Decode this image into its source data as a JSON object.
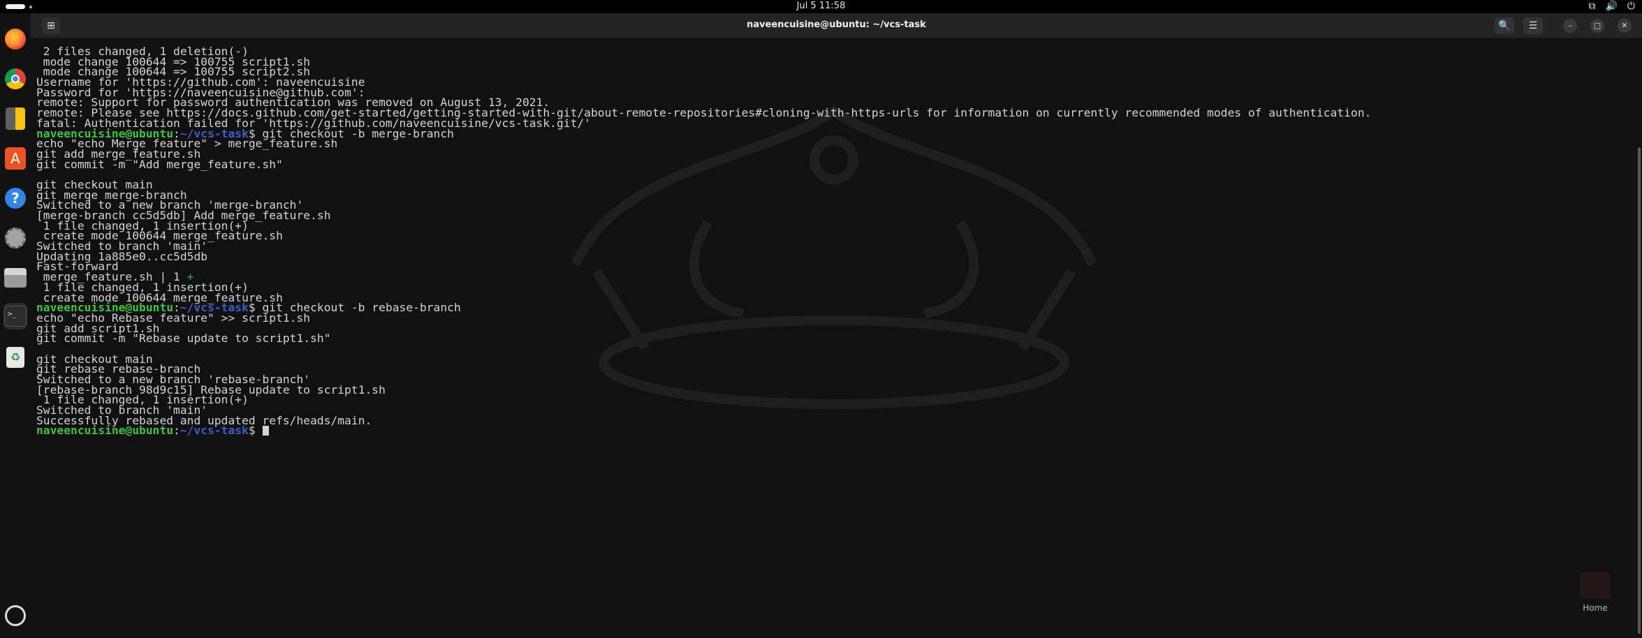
{
  "topbar": {
    "clock": "Jul 5  11:58",
    "tray_icons": [
      "network-icon",
      "volume-icon",
      "power-icon"
    ]
  },
  "dock": {
    "items": [
      {
        "name": "firefox",
        "icon": "firefox-icon"
      },
      {
        "name": "chrome",
        "icon": "chrome-icon"
      },
      {
        "name": "calculator",
        "icon": "calculator-icon"
      },
      {
        "name": "app-center",
        "icon": "app-store-icon",
        "glyph": "A"
      },
      {
        "name": "help",
        "icon": "help-icon",
        "glyph": "?"
      },
      {
        "name": "settings",
        "icon": "settings-icon"
      },
      {
        "name": "files",
        "icon": "files-icon"
      },
      {
        "name": "terminal",
        "icon": "terminal-icon",
        "glyph": ">_"
      },
      {
        "name": "trash",
        "icon": "trash-icon",
        "glyph": "♻"
      },
      {
        "name": "show-apps",
        "icon": "ubuntu-apps-icon"
      }
    ]
  },
  "window": {
    "title": "naveencuisine@ubuntu: ~/vcs-task",
    "buttons": {
      "search": "🔍",
      "menu": "☰",
      "minimize": "–",
      "maximize": "▢",
      "close": "✕"
    }
  },
  "terminal": {
    "prompt_user": "naveencuisine@ubuntu",
    "prompt_path": "~/vcs-task",
    "lines": [
      " 2 files changed, 1 deletion(-)",
      " mode change 100644 => 100755 script1.sh",
      " mode change 100644 => 100755 script2.sh",
      "Username for 'https://github.com': naveencuisine",
      "Password for 'https://naveencuisine@github.com':",
      "remote: Support for password authentication was removed on August 13, 2021.",
      "remote: Please see https://docs.github.com/get-started/getting-started-with-git/about-remote-repositories#cloning-with-https-urls for information on currently recommended modes of authentication.",
      "fatal: Authentication failed for 'https://github.com/naveencuisine/vcs-task.git/'",
      "@@PROMPT@@git checkout -b merge-branch",
      "echo \"echo Merge feature\" > merge_feature.sh",
      "git add merge_feature.sh",
      "git commit -m \"Add merge_feature.sh\"",
      "",
      "git checkout main",
      "git merge merge-branch",
      "Switched to a new branch 'merge-branch'",
      "[merge-branch cc5d5db] Add merge_feature.sh",
      " 1 file changed, 1 insertion(+)",
      " create mode 100644 merge_feature.sh",
      "Switched to branch 'main'",
      "Updating 1a885e0..cc5d5db",
      "Fast-forward",
      "@@DIFF@@ merge_feature.sh | 1 ",
      " 1 file changed, 1 insertion(+)",
      " create mode 100644 merge_feature.sh",
      "@@PROMPT@@git checkout -b rebase-branch",
      "echo \"echo Rebase feature\" >> script1.sh",
      "git add script1.sh",
      "git commit -m \"Rebase update to script1.sh\"",
      "",
      "git checkout main",
      "git rebase rebase-branch",
      "Switched to a new branch 'rebase-branch'",
      "[rebase-branch 98d9c15] Rebase update to script1.sh",
      " 1 file changed, 1 insertion(+)",
      "Switched to branch 'main'",
      "Successfully rebased and updated refs/heads/main.",
      "@@PROMPT_END@@"
    ],
    "diff_plus": "+"
  },
  "desktop": {
    "home_label": "Home"
  }
}
